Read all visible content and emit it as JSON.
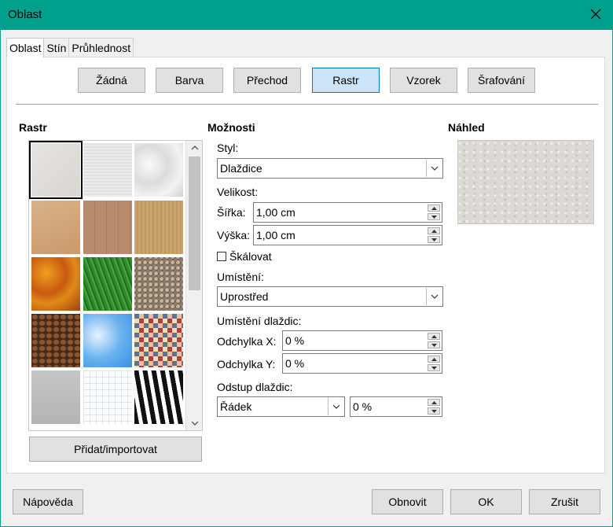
{
  "window": {
    "title": "Oblast"
  },
  "tabs": [
    {
      "label": "Oblast"
    },
    {
      "label": "Stín"
    },
    {
      "label": "Průhlednost"
    }
  ],
  "fill_types": [
    {
      "label": "Žádná",
      "selected": false
    },
    {
      "label": "Barva",
      "selected": false
    },
    {
      "label": "Přechod",
      "selected": false
    },
    {
      "label": "Rastr",
      "selected": true
    },
    {
      "label": "Vzorek",
      "selected": false
    },
    {
      "label": "Šrafování",
      "selected": false
    }
  ],
  "raster": {
    "title": "Rastr",
    "tiles": [
      {
        "name": "painted-white",
        "selected": true
      },
      {
        "name": "paper-texture",
        "selected": false
      },
      {
        "name": "paper-crumpled",
        "selected": false
      },
      {
        "name": "paper-graph",
        "selected": false
      },
      {
        "name": "parchment-paper",
        "selected": false
      },
      {
        "name": "fence",
        "selected": false
      },
      {
        "name": "wooden-board",
        "selected": false
      },
      {
        "name": "maple-leaves",
        "selected": false
      },
      {
        "name": "lawn",
        "selected": false
      },
      {
        "name": "colorful-pebbles",
        "selected": false
      },
      {
        "name": "coffee-beans",
        "selected": false
      },
      {
        "name": "clouds",
        "selected": false
      },
      {
        "name": "color-stripes",
        "selected": false
      },
      {
        "name": "concrete",
        "selected": false
      },
      {
        "name": "grid",
        "selected": false
      },
      {
        "name": "zebra",
        "selected": false
      }
    ],
    "add_import_label": "Přidat/importovat"
  },
  "options": {
    "title": "Možnosti",
    "style_label": "Styl:",
    "style_value": "Dlaždice",
    "size_label": "Velikost:",
    "width_label": "Šířka:",
    "width_value": "1,00 cm",
    "height_label": "Výška:",
    "height_value": "1,00 cm",
    "scale_label": "Škálovat",
    "scale_checked": false,
    "position_label": "Umístění:",
    "position_value": "Uprostřed",
    "tile_position_label": "Umístění dlaždic:",
    "offset_x_label": "Odchylka X:",
    "offset_x_value": "0 %",
    "offset_y_label": "Odchylka Y:",
    "offset_y_value": "0 %",
    "tile_offset_label": "Odstup dlaždic:",
    "tile_offset_mode": "Řádek",
    "tile_offset_value": "0 %"
  },
  "preview": {
    "title": "Náhled"
  },
  "footer": {
    "help_label": "Nápověda",
    "reset_label": "Obnovit",
    "ok_label": "OK",
    "cancel_label": "Zrušit"
  }
}
